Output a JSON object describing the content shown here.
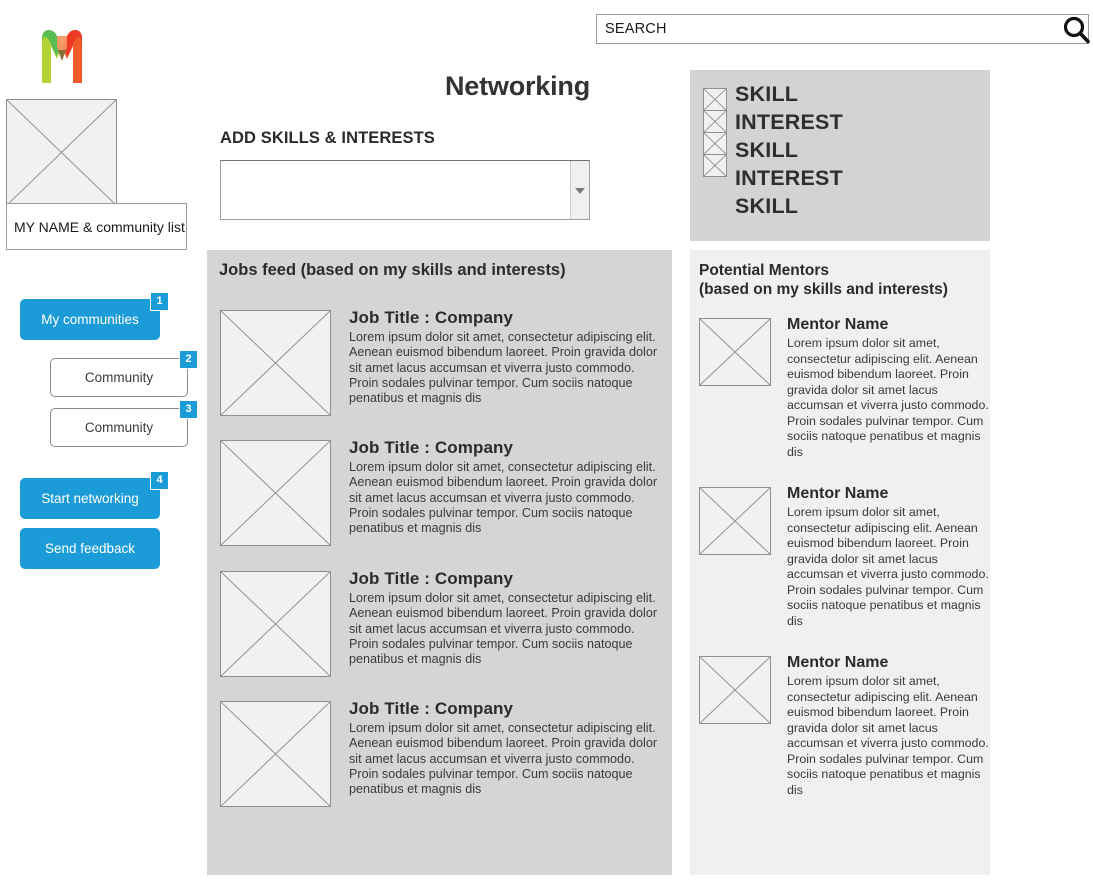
{
  "search": {
    "value": "SEARCH",
    "icon": "search-icon"
  },
  "logo": {
    "alt": "m-logo"
  },
  "profile": {
    "avatar_icon": "image-placeholder-icon",
    "name_label": "MY NAME & community list"
  },
  "sidebar": {
    "buttons": [
      {
        "label": "My communities",
        "badge": "1",
        "style": "primary"
      },
      {
        "label": "Community",
        "badge": "2",
        "style": "outline"
      },
      {
        "label": "Community",
        "badge": "3",
        "style": "outline"
      },
      {
        "label": "Start networking",
        "badge": "4",
        "style": "primary"
      },
      {
        "label": "Send feedback",
        "badge": "",
        "style": "primary"
      }
    ]
  },
  "main": {
    "title": "Networking",
    "add_skills_label": "ADD SKILLS & INTERESTS",
    "skills_select": {
      "value": "",
      "placeholder": "",
      "arrow_icon": "chevron-down-icon"
    }
  },
  "skills_panel": {
    "checkbox_icon": "checkbox-x-icon",
    "checkbox_count": 4,
    "items": [
      "SKILL",
      "INTEREST",
      "SKILL",
      "INTEREST",
      "SKILL"
    ]
  },
  "jobs_feed": {
    "title": "Jobs feed (based on my skills and interests)",
    "thumb_icon": "image-placeholder-icon",
    "items": [
      {
        "title": "Job Title : Company",
        "description": "Lorem ipsum dolor sit amet, consectetur adipiscing elit. Aenean euismod bibendum laoreet. Proin gravida dolor sit amet lacus accumsan et viverra justo commodo. Proin sodales pulvinar tempor. Cum sociis natoque penatibus et magnis dis"
      },
      {
        "title": "Job Title : Company",
        "description": "Lorem ipsum dolor sit amet, consectetur adipiscing elit. Aenean euismod bibendum laoreet. Proin gravida dolor sit amet lacus accumsan et viverra justo commodo. Proin sodales pulvinar tempor. Cum sociis natoque penatibus et magnis dis"
      },
      {
        "title": "Job Title : Company",
        "description": "Lorem ipsum dolor sit amet, consectetur adipiscing elit. Aenean euismod bibendum laoreet. Proin gravida dolor sit amet lacus accumsan et viverra justo commodo. Proin sodales pulvinar tempor. Cum sociis natoque penatibus et magnis dis"
      },
      {
        "title": "Job Title : Company",
        "description": "Lorem ipsum dolor sit amet, consectetur adipiscing elit. Aenean euismod bibendum laoreet. Proin gravida dolor sit amet lacus accumsan et viverra justo commodo. Proin sodales pulvinar tempor. Cum sociis natoque penatibus et magnis dis"
      }
    ]
  },
  "mentors": {
    "title_line1": "Potential Mentors",
    "title_line2": "(based on my skills and interests)",
    "thumb_icon": "image-placeholder-icon",
    "items": [
      {
        "name": "Mentor Name",
        "description": "Lorem ipsum dolor sit amet, consectetur adipiscing elit. Aenean euismod bibendum laoreet. Proin gravida dolor sit amet lacus accumsan et viverra justo commodo. Proin sodales pulvinar tempor. Cum sociis natoque penatibus et magnis dis"
      },
      {
        "name": "Mentor Name",
        "description": "Lorem ipsum dolor sit amet, consectetur adipiscing elit. Aenean euismod bibendum laoreet. Proin gravida dolor sit amet lacus accumsan et viverra justo commodo. Proin sodales pulvinar tempor. Cum sociis natoque penatibus et magnis dis"
      },
      {
        "name": "Mentor Name",
        "description": "Lorem ipsum dolor sit amet, consectetur adipiscing elit. Aenean euismod bibendum laoreet. Proin gravida dolor sit amet lacus accumsan et viverra justo commodo. Proin sodales pulvinar tempor. Cum sociis natoque penatibus et magnis dis"
      }
    ]
  },
  "colors": {
    "accent_blue": "#1b9bd8",
    "panel_dark": "#d5d5d5",
    "panel_light": "#f0f0f0",
    "skills_panel": "#d3d3d3"
  }
}
